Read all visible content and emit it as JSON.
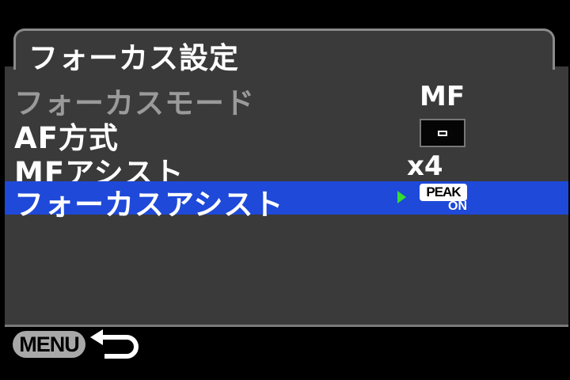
{
  "header": {
    "title": "フォーカス設定"
  },
  "menu": {
    "items": [
      {
        "label": "フォーカスモード",
        "value": "MF",
        "state": "disabled"
      },
      {
        "label": "AF方式",
        "value_icon": "af-area-spot-icon",
        "state": "normal"
      },
      {
        "label": "MFアシスト",
        "value": "x4",
        "state": "normal"
      },
      {
        "label": "フォーカスアシスト",
        "value_icon": "peak-on-icon",
        "value_top": "PEAK",
        "value_bottom": "ON",
        "state": "selected"
      }
    ]
  },
  "footer": {
    "menu_label": "MENU",
    "back_icon": "return-arrow-icon"
  },
  "colors": {
    "background": "#000000",
    "panel": "#3a3a3a",
    "selected": "#1f49d8",
    "disabled_text": "#9a9a9a",
    "arrow": "#33dd33"
  }
}
